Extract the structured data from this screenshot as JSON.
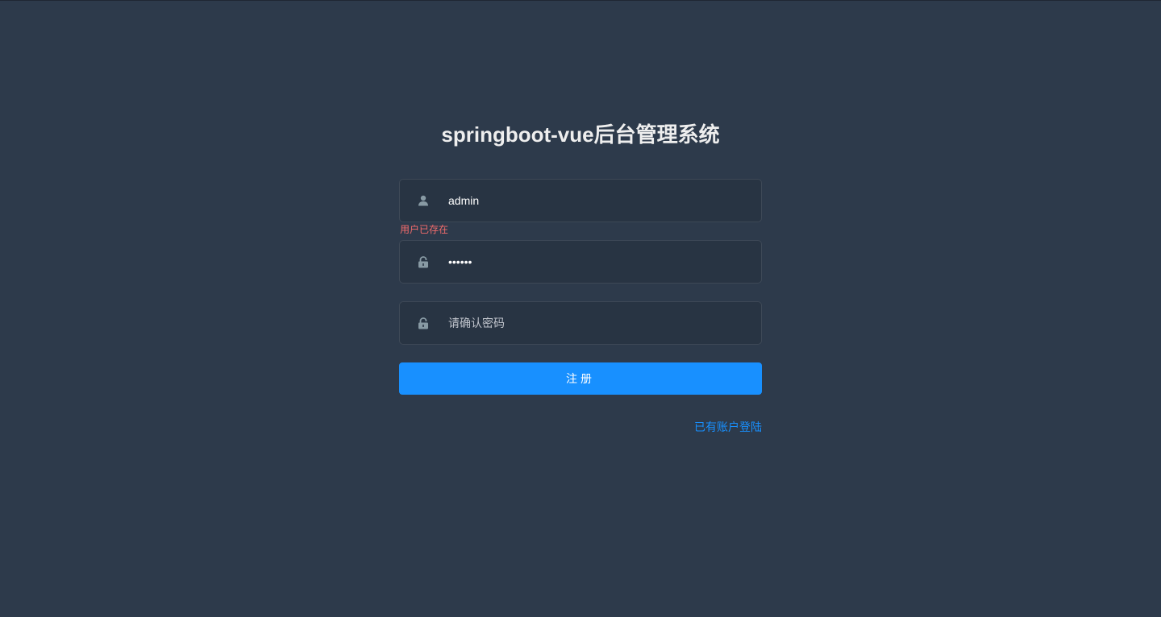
{
  "title": "springboot-vue后台管理系统",
  "form": {
    "username": {
      "value": "admin",
      "icon": "user-icon"
    },
    "username_error": "用户已存在",
    "password": {
      "value": "123456",
      "icon": "lock-icon"
    },
    "confirm_password": {
      "value": "",
      "placeholder": "请确认密码",
      "icon": "lock-icon"
    },
    "submit_label": "注册",
    "login_link": "已有账户登陆"
  },
  "colors": {
    "background": "#2d3a4b",
    "field_background": "#283443",
    "accent": "#1890ff",
    "error": "#f56c6c",
    "icon": "#889aa4"
  }
}
